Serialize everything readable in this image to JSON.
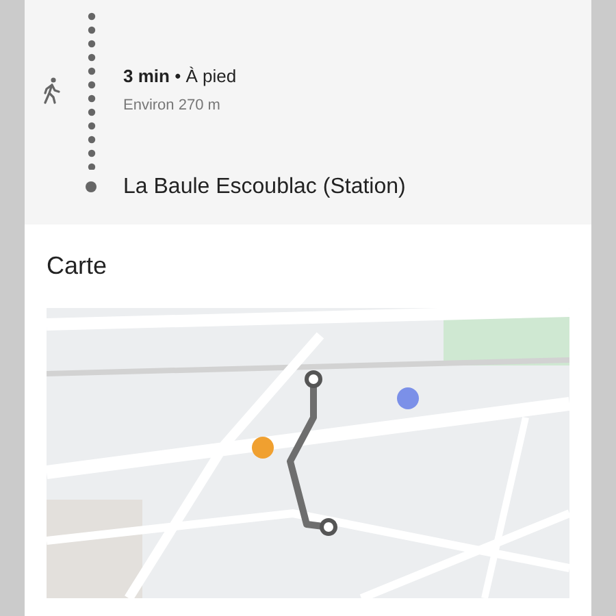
{
  "step": {
    "duration": "3 min",
    "separator": "•",
    "mode": "À pied",
    "distance": "Environ 270 m"
  },
  "destination": "La Baule Escoublac (Station)",
  "map_section": {
    "title": "Carte"
  }
}
